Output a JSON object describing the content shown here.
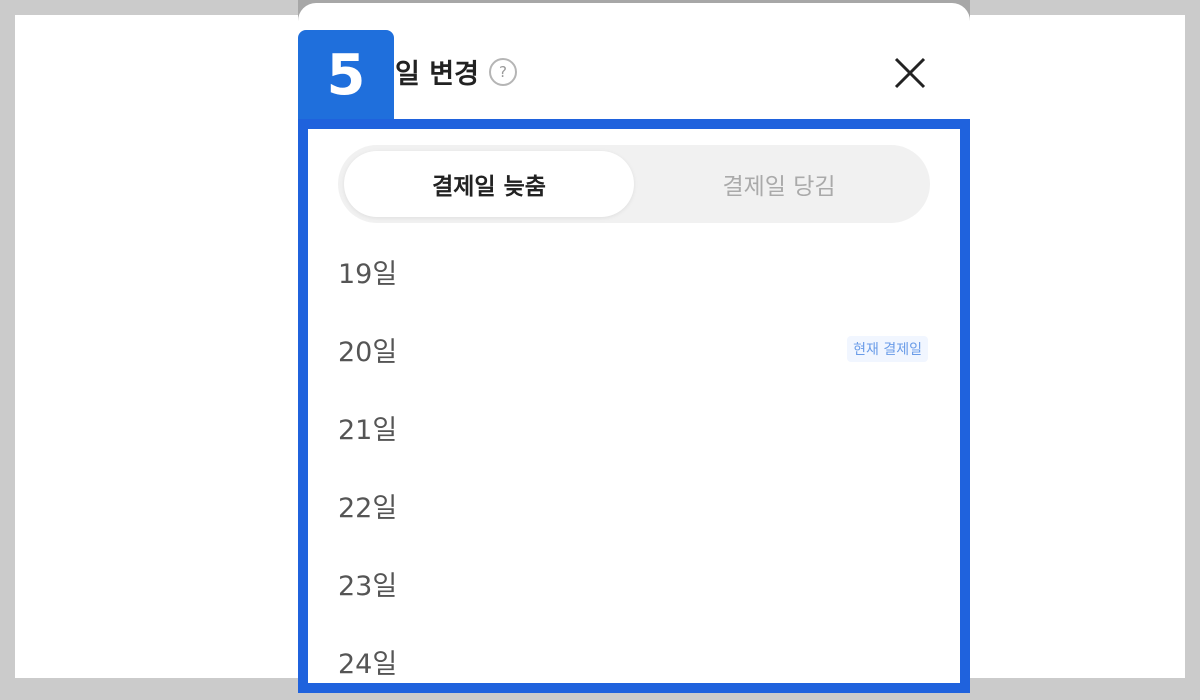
{
  "step_number": "5",
  "sheet": {
    "title": "일 변경",
    "help_icon": "question-circle-icon",
    "close_icon": "close-x-icon"
  },
  "tabs": [
    {
      "label": "결제일 늦춤",
      "active": true
    },
    {
      "label": "결제일 당김",
      "active": false
    }
  ],
  "days": [
    {
      "label": "19일",
      "tag": ""
    },
    {
      "label": "20일",
      "tag": "현재 결제일"
    },
    {
      "label": "21일",
      "tag": ""
    },
    {
      "label": "22일",
      "tag": ""
    },
    {
      "label": "23일",
      "tag": ""
    },
    {
      "label": "24일",
      "tag": ""
    }
  ],
  "colors": {
    "highlight": "#1f62dd",
    "badge": "#1f6fdc",
    "current_tag_text": "#6a9ce8"
  }
}
